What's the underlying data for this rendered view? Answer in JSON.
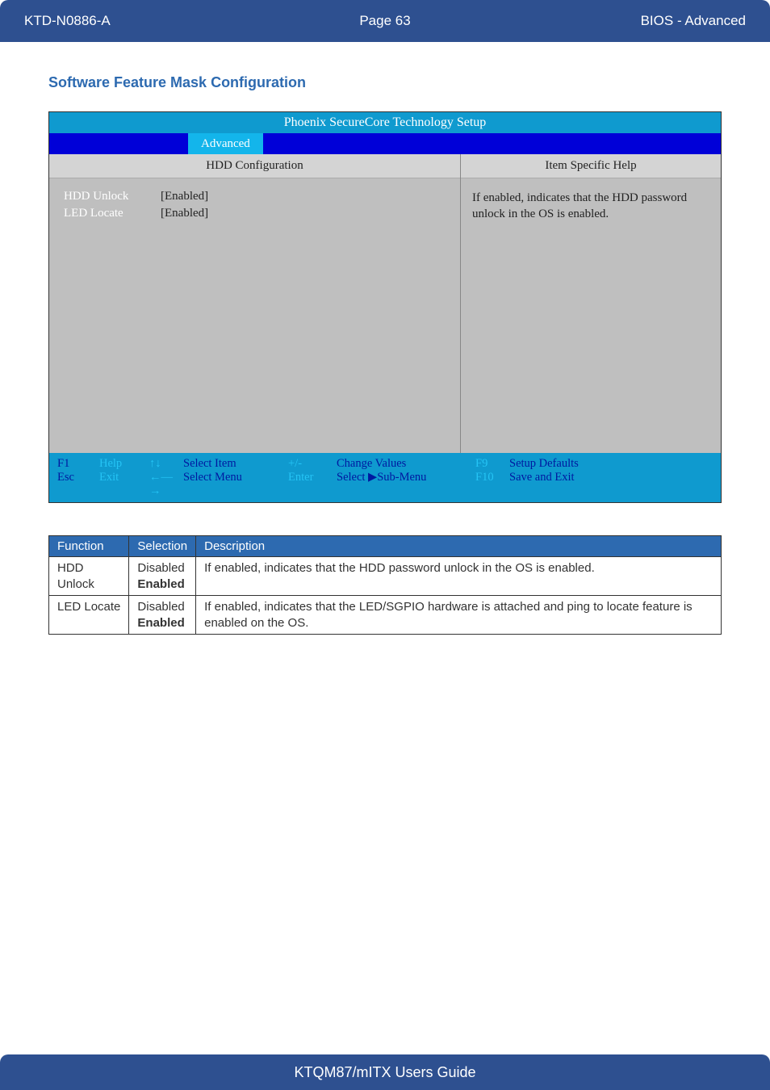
{
  "header": {
    "doc_id": "KTD-N0886-A",
    "page": "Page 63",
    "section": "BIOS  - Advanced"
  },
  "section_title": "Software Feature Mask Configuration",
  "bios": {
    "title": "Phoenix SecureCore Technology Setup",
    "active_tab": "Advanced",
    "left_header": "HDD Configuration",
    "right_header": "Item Specific Help",
    "settings": [
      {
        "label": "HDD Unlock",
        "value": "[Enabled]"
      },
      {
        "label": "LED Locate",
        "value": "[Enabled]"
      }
    ],
    "help_text": "If enabled, indicates that the HDD password unlock in the OS is enabled.",
    "footer": {
      "r1": {
        "k1": "F1",
        "l1": "Help",
        "a1": "↑↓",
        "act1": "Select Item",
        "pm": "+/-",
        "cv": "Change Values",
        "fn": "F9",
        "final": "Setup Defaults"
      },
      "r2": {
        "k1": "Esc",
        "l1": "Exit",
        "a1": "←—→",
        "act1": "Select Menu",
        "pm": "Enter",
        "cv": "Select ▶Sub-Menu",
        "fn": "F10",
        "final": "Save and Exit"
      }
    }
  },
  "table": {
    "headers": {
      "c1": "Function",
      "c2": "Selection",
      "c3": "Description"
    },
    "rows": [
      {
        "function": "HDD Unlock",
        "sel1": "Disabled",
        "sel2": "Enabled",
        "desc": "If enabled, indicates that the HDD password unlock in the OS is enabled."
      },
      {
        "function": "LED Locate",
        "sel1": "Disabled",
        "sel2": "Enabled",
        "desc": "If enabled, indicates that the LED/SGPIO hardware is attached and ping to locate  feature is enabled on the OS."
      }
    ]
  },
  "footer_text": "KTQM87/mITX Users Guide"
}
